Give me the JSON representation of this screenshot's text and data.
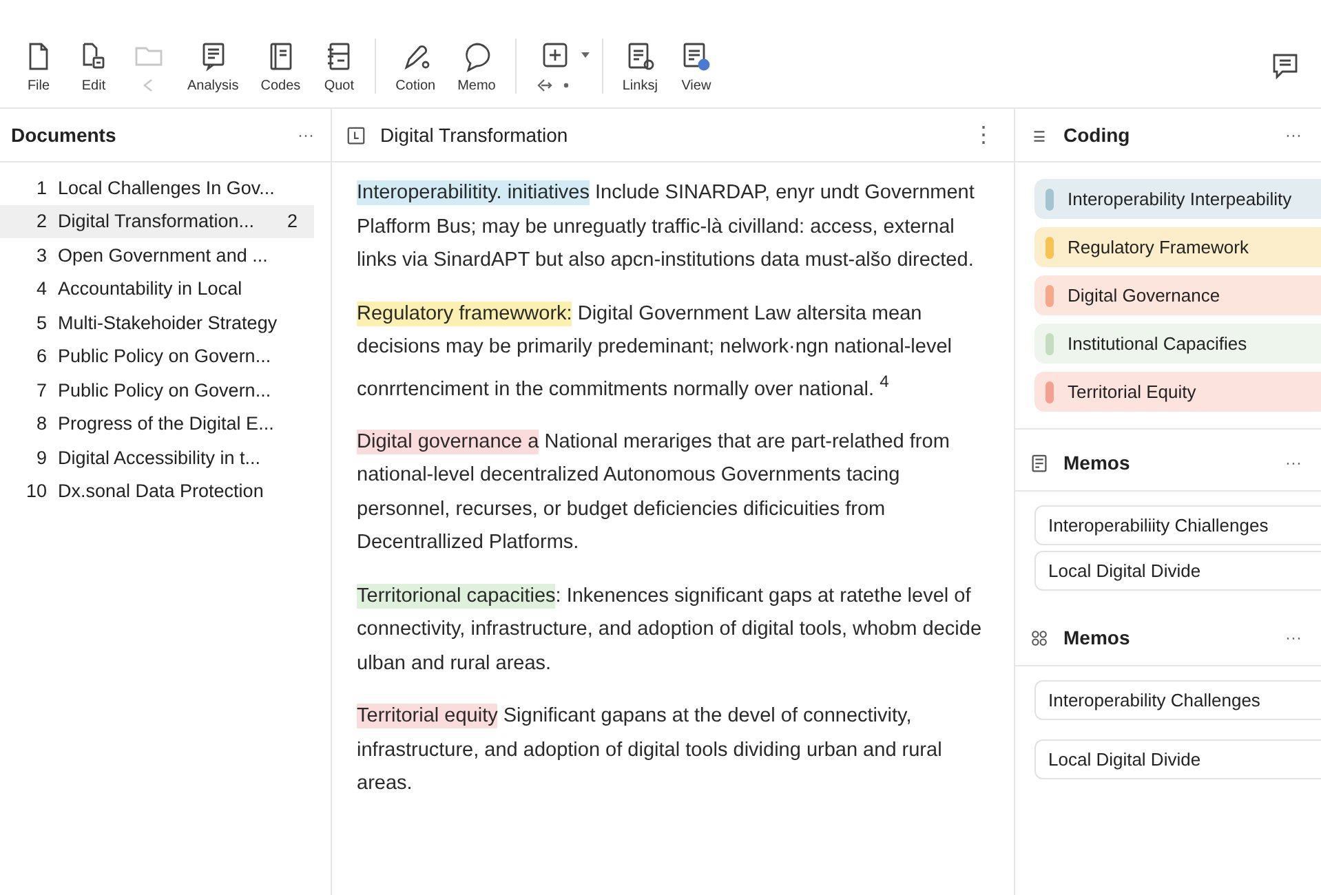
{
  "toolbar": {
    "tools": [
      {
        "label": "File",
        "disabled": false
      },
      {
        "label": "Edit",
        "disabled": false
      },
      {
        "disabled": true
      },
      {
        "label": "Analysis",
        "disabled": false
      },
      {
        "label": "Codes",
        "disabled": false
      },
      {
        "label": "Quot",
        "disabled": false
      },
      {
        "label": "Cotion",
        "disabled": false
      },
      {
        "label": "Memo",
        "disabled": false
      },
      {
        "disabled": false
      },
      {
        "label": "Linksj",
        "disabled": false
      },
      {
        "label": "View",
        "disabled": false
      }
    ]
  },
  "documents": {
    "title": "Documents",
    "menu": "···",
    "items": [
      {
        "number": "1",
        "title": "Local Challenges In Gov...",
        "selected": false
      },
      {
        "number": "2",
        "title": "Digital Transformation...",
        "count": "2",
        "selected": true
      },
      {
        "number": "3",
        "title": "Open Government and ...",
        "selected": false
      },
      {
        "number": "4",
        "title": "Accountability in Local",
        "selected": false
      },
      {
        "number": "5",
        "title": "Multi-Stakehoider Strategy",
        "selected": false
      },
      {
        "number": "6",
        "title": "Public Policy on Govern...",
        "selected": false
      },
      {
        "number": "7",
        "title": "Public Policy on Govern...",
        "selected": false
      },
      {
        "number": "8",
        "title": "Progress of the Digital E...",
        "selected": false
      },
      {
        "number": "9",
        "title": "Digital Accessibility in t...",
        "selected": false
      },
      {
        "number": "10",
        "title": "Dx.sonal Data Protection",
        "selected": false
      }
    ]
  },
  "editor": {
    "title": "Digital Transformation",
    "menu": "⋮",
    "paragraphs": [
      {
        "highlight": "Interoperabilitity. initiatives",
        "color": "#d3ebf5",
        "text": " Include SINARDAP, enyr undt Government Plafform Bus; may be unreguatly traffic-là civilland: access, external links via SinardAPT but also apcn-institutions data must-alšo directed."
      },
      {
        "highlight": "Regulatory framewwork:",
        "color": "#fbf0b0",
        "text": " Digital Government Law altersita mean decisions may be primarily predeminant; nelwork·ngn national-level conrrtenciment in the commitments normally over national. $^{4}$"
      },
      {
        "highlight": "Digital governance a",
        "color": "#fbdcdc",
        "text": " National merariges that are part-relathed from national-level decentralized Autonomous Governments tacing personnel, recurses, or budget deficiencies dificicuities from Decentrallized Platforms."
      },
      {
        "highlight": "Territorional capacities",
        "color": "#dff0dc",
        "text": ": Inkenences significant gaps at ratethe level of connectivity, infrastructure, and adoption of digital tools, whobm decide ulban and rural areas."
      },
      {
        "highlight": "Territorial equity",
        "color": "#fbdcdc",
        "text": " Significant gapans at the devel of connectivity, infrastructure, and adoption of digital tools dividing urban and rural areas."
      }
    ]
  },
  "coding": {
    "title": "Coding",
    "menu": "···",
    "codes": [
      {
        "label": "Interoperability Interpeability",
        "color": "#a3c4d0"
      },
      {
        "label": "Regulatory Framework",
        "color": "#f5c453"
      },
      {
        "label": "Digital Governance",
        "color": "#f5a88c"
      },
      {
        "label": "Institutional Capacifies",
        "color": "#c6dcc0"
      },
      {
        "label": "Territorial Equity",
        "color": "#f4a090"
      }
    ]
  },
  "memo_sections": [
    {
      "title": "Memos",
      "menu": "···",
      "items": [
        "Interoperabiliity Chiallenges",
        "Local Digital Divide"
      ]
    },
    {
      "title": "Memos",
      "menu": "···",
      "items": [
        "Interoperability Challenges",
        "Local Digital Divide"
      ]
    }
  ]
}
